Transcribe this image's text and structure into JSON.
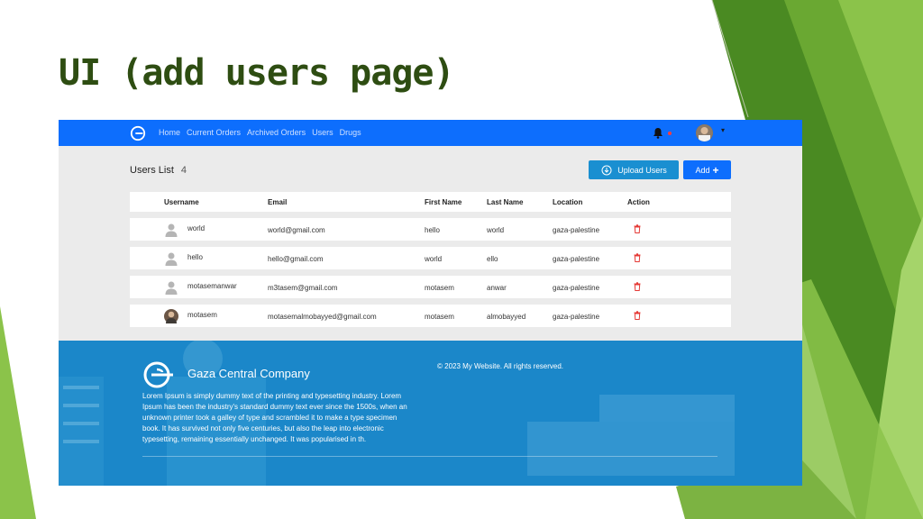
{
  "slide": {
    "title": "UI (add users page)"
  },
  "colors": {
    "navbar": "#0d6efd",
    "upload_button": "#1a8fd1",
    "footer": "#1b87c9",
    "title": "#2e4d12",
    "delete_icon": "#e53935",
    "deco_green_light": "#8bc34a",
    "deco_green_dark": "#4a8a22"
  },
  "navbar": {
    "logo_icon": "company-logo-icon",
    "links": [
      "Home",
      "Current Orders",
      "Archived Orders",
      "Users",
      "Drugs"
    ],
    "bell_icon": "bell-icon",
    "avatar_icon": "avatar-icon",
    "caret_icon": "caret-down-icon"
  },
  "users_list": {
    "title": "Users List",
    "count": "4",
    "upload_button_label": "Upload Users",
    "add_button_label": "Add",
    "add_icon_glyph": "+"
  },
  "table": {
    "headers": {
      "username": "Username",
      "email": "Email",
      "first_name": "First Name",
      "last_name": "Last Name",
      "location": "Location",
      "action": "Action"
    },
    "rows": [
      {
        "username": "world",
        "email": "world@gmail.com",
        "first_name": "hello",
        "last_name": "world",
        "location": "gaza-palestine",
        "avatar": "default-user-icon"
      },
      {
        "username": "hello",
        "email": "hello@gmail.com",
        "first_name": "world",
        "last_name": "ello",
        "location": "gaza-palestine",
        "avatar": "default-user-icon"
      },
      {
        "username": "motasemanwar",
        "email": "m3tasem@gmail.com",
        "first_name": "motasem",
        "last_name": "anwar",
        "location": "gaza-palestine",
        "avatar": "default-user-icon"
      },
      {
        "username": "motasem",
        "email": "motasemalmobayyed@gmail.com",
        "first_name": "motasem",
        "last_name": "almobayyed",
        "location": "gaza-palestine",
        "avatar": "photo-avatar-icon"
      }
    ]
  },
  "footer": {
    "company_name": "Gaza Central Company",
    "copyright": "© 2023 My Website. All rights reserved.",
    "description": "Lorem Ipsum is simply dummy text of the printing and typesetting industry. Lorem Ipsum has been the industry's standard dummy text ever since the 1500s, when an unknown printer took a galley of type and scrambled it to make a type specimen book. It has survived not only five centuries, but also the leap into electronic typesetting, remaining essentially unchanged. It was popularised in th."
  }
}
